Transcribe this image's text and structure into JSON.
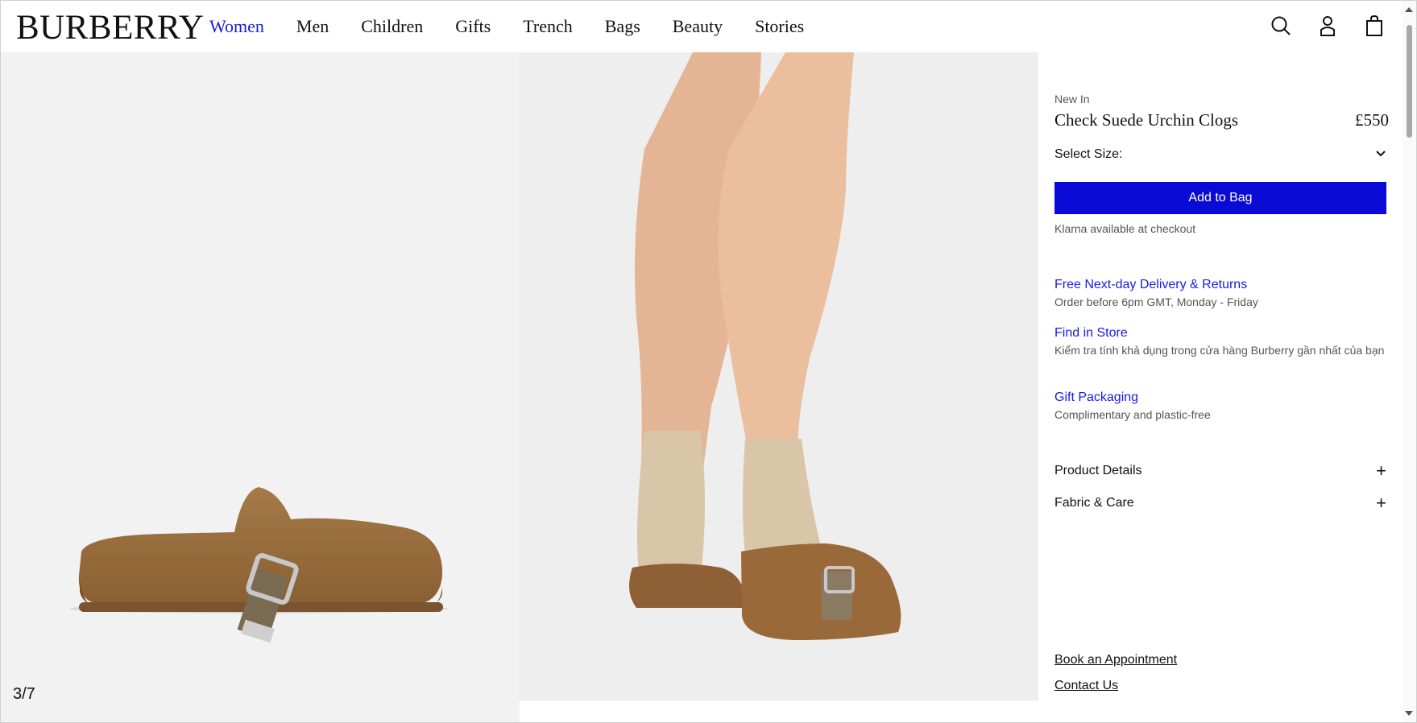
{
  "brand": {
    "logo": "BURBERRY"
  },
  "nav": {
    "items": [
      {
        "label": "Women",
        "active": true
      },
      {
        "label": "Men"
      },
      {
        "label": "Children"
      },
      {
        "label": "Gifts"
      },
      {
        "label": "Trench"
      },
      {
        "label": "Bags"
      },
      {
        "label": "Beauty"
      },
      {
        "label": "Stories"
      }
    ]
  },
  "header_icons": [
    "search-icon",
    "account-icon",
    "shopping-bag-icon"
  ],
  "gallery": {
    "counter": "3/7"
  },
  "product": {
    "eyebrow": "New In",
    "title": "Check Suede Urchin Clogs",
    "price": "£550",
    "size_label": "Select Size:",
    "add_to_bag": "Add to Bag",
    "klarna": "Klarna available at checkout"
  },
  "services": [
    {
      "link": "Free Next-day Delivery & Returns",
      "desc": "Order before 6pm GMT, Monday - Friday"
    },
    {
      "link": "Find in Store",
      "desc": "Kiểm tra tính khả dụng trong cửa hàng Burberry gần nhất của bạn"
    },
    {
      "link": "Gift Packaging",
      "desc": "Complimentary and plastic-free"
    }
  ],
  "accordion": [
    {
      "label": "Product Details"
    },
    {
      "label": "Fabric & Care"
    }
  ],
  "footer_links": {
    "appointment": "Book an Appointment",
    "contact": "Contact Us"
  },
  "colors": {
    "accent": "#0a0ad6",
    "link": "#1a1ae0",
    "suede": "#9a6e3e"
  }
}
